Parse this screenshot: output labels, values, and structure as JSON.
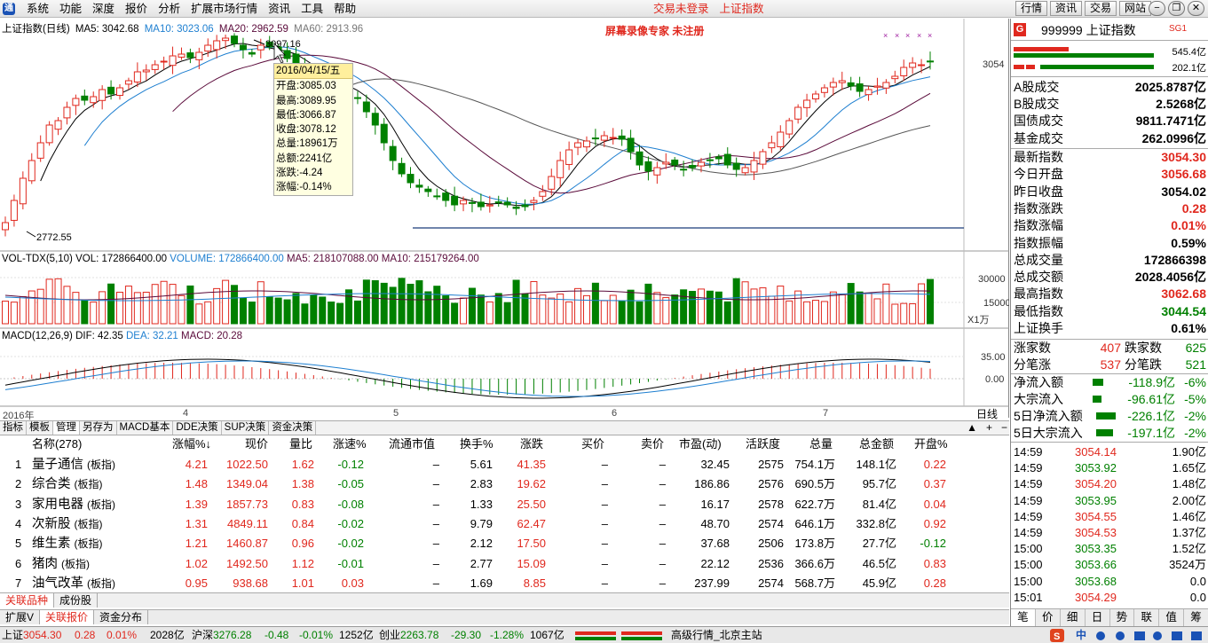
{
  "menu": {
    "logo": "通",
    "items": [
      "系统",
      "功能",
      "深度",
      "报价",
      "分析",
      "扩展市场行情",
      "资讯",
      "工具",
      "帮助"
    ],
    "status_login": "交易未登录",
    "status_index": "上证指数",
    "top_buttons": [
      "行情",
      "资讯",
      "交易",
      "网站"
    ],
    "win_buttons": [
      "−",
      "❐",
      "✕"
    ]
  },
  "chart": {
    "legend": {
      "title": "上证指数(日线)",
      "ma5": "MA5: 3042.68",
      "ma10": "MA10: 3023.06",
      "ma20": "MA20: 2962.59",
      "ma60": "MA60: 2913.96"
    },
    "watermark": "屏幕录像专家  未注册",
    "high_label": "3097.16",
    "low_label": "2772.55",
    "price_axis_label": "3054",
    "vol_legend": {
      "name": "VOL-TDX(5,10)",
      "vol": "VOL: 172866400.00",
      "volume": "VOLUME: 172866400.00",
      "ma5": "MA5: 218107088.00",
      "ma10": "MA10: 215179264.00"
    },
    "vol_axis": [
      "30000",
      "15000",
      "X1万"
    ],
    "macd_legend": {
      "name": "MACD(12,26,9)",
      "dif": "DIF: 42.35",
      "dea": "DEA: 32.21",
      "macd": "MACD: 20.28"
    },
    "macd_axis": [
      "35.00",
      "0.00"
    ],
    "x_labels": [
      "2016年",
      "4",
      "5",
      "6",
      "7"
    ],
    "day_label": "日线",
    "colors": {
      "up": "#e0281e",
      "down": "#008000",
      "ma5": "#000000",
      "ma10": "#1e7fd0",
      "ma20": "#5a0a3a",
      "ma60": "#555555"
    }
  },
  "info_box": {
    "date": "2016/04/15/五",
    "lines": [
      "开盘:3085.03",
      "最高:3089.95",
      "最低:3066.87",
      "收盘:3078.12",
      "总量:18961万",
      "总额:2241亿",
      "涨跌:-4.24",
      "涨幅:-0.14%"
    ]
  },
  "tabs": {
    "items": [
      "指标",
      "模板",
      "管理",
      "另存为",
      "MACD基本",
      "DDE决策",
      "SUP决策",
      "资金决策"
    ],
    "active": "管理",
    "controls": [
      "▲",
      "+",
      "−"
    ]
  },
  "table": {
    "headers": [
      "名称(278)",
      "涨幅%↓",
      "现价",
      "量比",
      "涨速%",
      "流通市值",
      "换手%",
      "涨跌",
      "买价",
      "卖价",
      "市盈(动)",
      "活跃度",
      "总量",
      "总金额",
      "开盘%"
    ],
    "rows": [
      {
        "idx": "1",
        "name": "量子通信",
        "tag": "(板指)",
        "chg": "4.21",
        "price": "1022.50",
        "lb": "1.62",
        "speed": "-0.12",
        "mv": "–",
        "turn": "5.61",
        "zd": "41.35",
        "buy": "–",
        "sell": "–",
        "pe": "32.45",
        "act": "2575",
        "vol": "754.1万",
        "amt": "148.1亿",
        "open": "0.22"
      },
      {
        "idx": "2",
        "name": "综合类",
        "tag": "(板指)",
        "chg": "1.48",
        "price": "1349.04",
        "lb": "1.38",
        "speed": "-0.05",
        "mv": "–",
        "turn": "2.83",
        "zd": "19.62",
        "buy": "–",
        "sell": "–",
        "pe": "186.86",
        "act": "2576",
        "vol": "690.5万",
        "amt": "95.7亿",
        "open": "0.37"
      },
      {
        "idx": "3",
        "name": "家用电器",
        "tag": "(板指)",
        "chg": "1.39",
        "price": "1857.73",
        "lb": "0.83",
        "speed": "-0.08",
        "mv": "–",
        "turn": "1.33",
        "zd": "25.50",
        "buy": "–",
        "sell": "–",
        "pe": "16.17",
        "act": "2578",
        "vol": "622.7万",
        "amt": "81.4亿",
        "open": "0.04"
      },
      {
        "idx": "4",
        "name": "次新股",
        "tag": "(板指)",
        "chg": "1.31",
        "price": "4849.11",
        "lb": "0.84",
        "speed": "-0.02",
        "mv": "–",
        "turn": "9.79",
        "zd": "62.47",
        "buy": "–",
        "sell": "–",
        "pe": "48.70",
        "act": "2574",
        "vol": "646.1万",
        "amt": "332.8亿",
        "open": "0.92"
      },
      {
        "idx": "5",
        "name": "维生素",
        "tag": "(板指)",
        "chg": "1.21",
        "price": "1460.87",
        "lb": "0.96",
        "speed": "-0.02",
        "mv": "–",
        "turn": "2.12",
        "zd": "17.50",
        "buy": "–",
        "sell": "–",
        "pe": "37.68",
        "act": "2506",
        "vol": "173.8万",
        "amt": "27.7亿",
        "open": "-0.12"
      },
      {
        "idx": "6",
        "name": "猪肉",
        "tag": "(板指)",
        "chg": "1.02",
        "price": "1492.50",
        "lb": "1.12",
        "speed": "-0.01",
        "mv": "–",
        "turn": "2.77",
        "zd": "15.09",
        "buy": "–",
        "sell": "–",
        "pe": "22.12",
        "act": "2536",
        "vol": "366.6万",
        "amt": "46.5亿",
        "open": "0.83"
      },
      {
        "idx": "7",
        "name": "油气改革",
        "tag": "(板指)",
        "chg": "0.95",
        "price": "938.68",
        "lb": "1.01",
        "speed": "0.03",
        "mv": "–",
        "turn": "1.69",
        "zd": "8.85",
        "buy": "–",
        "sell": "–",
        "pe": "237.99",
        "act": "2574",
        "vol": "568.7万",
        "amt": "45.9亿",
        "open": "0.28"
      }
    ]
  },
  "bottom_tabs": [
    "关联品种",
    "成份股"
  ],
  "bottom_tabs2": [
    "扩展V",
    "关联报价",
    "资金分布"
  ],
  "statusbar": {
    "sh_label": "上证",
    "sh_val": "3054.30",
    "sh_chg": "0.28",
    "sh_pct": "0.01%",
    "sh_amt": "2028亿",
    "hs_label": "沪深",
    "hs_val": "3276.28",
    "hs_chg": "-0.48",
    "hs_pct": "-0.01%",
    "hs_amt": "1252亿",
    "cy_label": "创业",
    "cy_val": "2263.78",
    "cy_chg": "-29.30",
    "cy_pct": "-1.28%",
    "cy_amt": "1067亿",
    "server": "高级行情_北京主站",
    "ime": "中"
  },
  "right_panel": {
    "g": "G",
    "code_name": "999999 上证指数",
    "sg": "SG1",
    "bar_top_val": "545.4亿",
    "bar_bot_val": "202.1亿",
    "group1": [
      {
        "label": "A股成交",
        "value": "2025.8787亿",
        "color": "blk"
      },
      {
        "label": "B股成交",
        "value": "2.5268亿",
        "color": "blk"
      },
      {
        "label": "国债成交",
        "value": "9811.7471亿",
        "color": "blk"
      },
      {
        "label": "基金成交",
        "value": "262.0996亿",
        "color": "blk"
      }
    ],
    "group2": [
      {
        "label": "最新指数",
        "value": "3054.30",
        "color": "red"
      },
      {
        "label": "今日开盘",
        "value": "3056.68",
        "color": "red"
      },
      {
        "label": "昨日收盘",
        "value": "3054.02",
        "color": "blk"
      },
      {
        "label": "指数涨跌",
        "value": "0.28",
        "color": "red"
      },
      {
        "label": "指数涨幅",
        "value": "0.01%",
        "color": "red"
      },
      {
        "label": "指数振幅",
        "value": "0.59%",
        "color": "blk"
      },
      {
        "label": "总成交量",
        "value": "172866398",
        "color": "blk"
      },
      {
        "label": "总成交额",
        "value": "2028.4056亿",
        "color": "blk"
      },
      {
        "label": "最高指数",
        "value": "3062.68",
        "color": "red"
      },
      {
        "label": "最低指数",
        "value": "3044.54",
        "color": "green"
      },
      {
        "label": "上证换手",
        "value": "0.61%",
        "color": "blk"
      }
    ],
    "updown": {
      "up_label": "涨家数",
      "up_val": "407",
      "down_label": "跌家数",
      "down_val": "625",
      "upb_label": "分笔涨",
      "upb_val": "537",
      "downb_label": "分笔跌",
      "downb_val": "521"
    },
    "flows": [
      {
        "label": "净流入额",
        "value": "-118.9亿",
        "pct": "-6%",
        "bar": 0.3
      },
      {
        "label": "大宗流入",
        "value": "-96.61亿",
        "pct": "-5%",
        "bar": 0.25
      },
      {
        "label": "5日净流入额",
        "value": "-226.1亿",
        "pct": "-2%",
        "bar": 0.55
      },
      {
        "label": "5日大宗流入",
        "value": "-197.1亿",
        "pct": "-2%",
        "bar": 0.48
      }
    ],
    "ticks": [
      {
        "t": "14:59",
        "p": "3054.14",
        "v": "1.90亿",
        "c": "red"
      },
      {
        "t": "14:59",
        "p": "3053.92",
        "v": "1.65亿",
        "c": "green"
      },
      {
        "t": "14:59",
        "p": "3054.20",
        "v": "1.48亿",
        "c": "red"
      },
      {
        "t": "14:59",
        "p": "3053.95",
        "v": "2.00亿",
        "c": "green"
      },
      {
        "t": "14:59",
        "p": "3054.55",
        "v": "1.46亿",
        "c": "red"
      },
      {
        "t": "14:59",
        "p": "3054.53",
        "v": "1.37亿",
        "c": "red"
      },
      {
        "t": "15:00",
        "p": "3053.35",
        "v": "1.52亿",
        "c": "green"
      },
      {
        "t": "15:00",
        "p": "3053.66",
        "v": "3524万",
        "c": "green"
      },
      {
        "t": "15:00",
        "p": "3053.68",
        "v": "0.0",
        "c": "green"
      },
      {
        "t": "15:01",
        "p": "3054.29",
        "v": "0.0",
        "c": "red"
      }
    ],
    "tabs": [
      "笔",
      "价",
      "细",
      "日",
      "势",
      "联",
      "值",
      "筹"
    ],
    "active_tab": "笔"
  }
}
